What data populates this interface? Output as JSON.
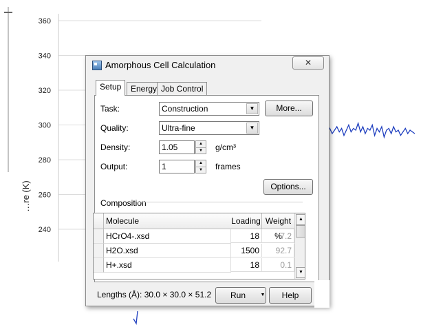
{
  "chart_data": {
    "type": "line",
    "ylabel": "…re (K)",
    "y_ticks": [
      360,
      340,
      320,
      300,
      280,
      260,
      240
    ],
    "ylim": [
      230,
      365
    ],
    "series": [
      {
        "color": "#1f3fbf",
        "values": [
          296,
          298,
          295,
          297,
          299,
          296,
          298,
          294,
          297,
          300,
          296,
          298,
          297,
          301,
          296,
          299,
          295,
          298,
          297,
          300,
          294,
          298,
          296,
          299,
          293,
          297,
          298,
          295,
          299,
          296,
          297,
          294,
          296,
          298,
          295,
          297,
          296,
          295
        ]
      }
    ]
  },
  "dialog": {
    "title": "Amorphous Cell Calculation",
    "close_glyph": "✕",
    "tabs": [
      "Setup",
      "Energy",
      "Job Control"
    ],
    "task": {
      "label": "Task:",
      "value": "Construction",
      "more_label": "More..."
    },
    "quality": {
      "label": "Quality:",
      "value": "Ultra-fine"
    },
    "density": {
      "label": "Density:",
      "value": "1.05",
      "unit": "g/cm³"
    },
    "output": {
      "label": "Output:",
      "value": "1",
      "unit": "frames"
    },
    "options_label": "Options...",
    "composition_label": "Composition",
    "table": {
      "headers": [
        "Molecule",
        "Loading",
        "Weight %"
      ],
      "rows": [
        {
          "molecule": "HCrO4-.xsd",
          "loading": "18",
          "weight": "7.2"
        },
        {
          "molecule": "H2O.xsd",
          "loading": "1500",
          "weight": "92.7"
        },
        {
          "molecule": "H+.xsd",
          "loading": "18",
          "weight": "0.1"
        }
      ]
    },
    "lengths": "Lengths (Å): 30.0 × 30.0 × 51.2",
    "run_label": "Run",
    "help_label": "Help"
  }
}
